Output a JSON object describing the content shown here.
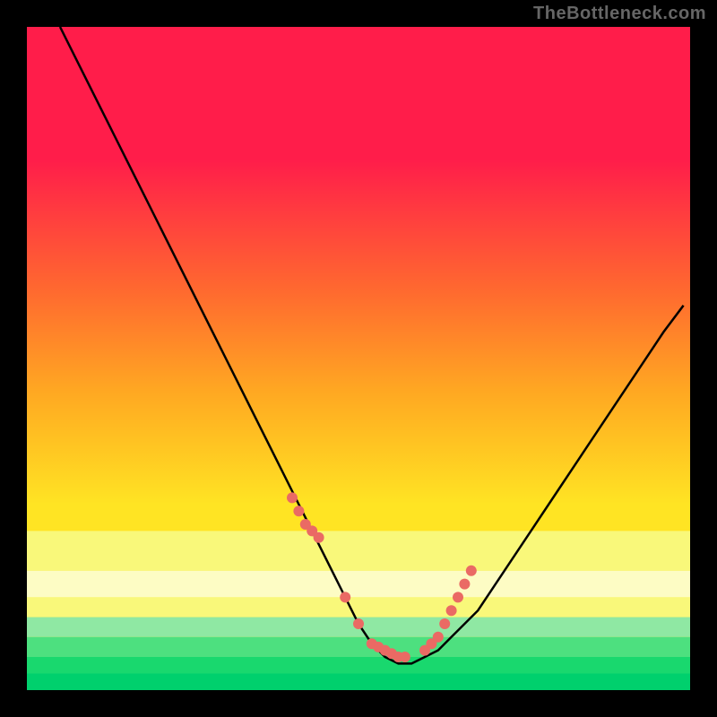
{
  "watermark": "TheBottleneck.com",
  "colors": {
    "bg": "#000000",
    "curve": "#000000",
    "points": "#ea6a64",
    "top": "#ff1d4a",
    "mid_red_orange": "#ff6a2f",
    "mid_orange": "#ffa822",
    "mid_yellow": "#ffe423",
    "band_light_yellow": "#f9f87a",
    "band_pale_yellow": "#fdfcc4",
    "band_mint1": "#8fe8a3",
    "band_mint2": "#4de07f",
    "band_green": "#19d86e",
    "band_green2": "#00d06d"
  },
  "chart_data": {
    "type": "line",
    "title": "",
    "xlabel": "",
    "ylabel": "",
    "xlim": [
      0,
      100
    ],
    "ylim": [
      0,
      100
    ],
    "curve": {
      "x": [
        5,
        8,
        12,
        16,
        20,
        24,
        28,
        32,
        36,
        40,
        44,
        46,
        48,
        50,
        52,
        54,
        56,
        58,
        60,
        62,
        64,
        68,
        72,
        76,
        80,
        84,
        88,
        92,
        96,
        99
      ],
      "y": [
        100,
        94,
        86,
        78,
        70,
        62,
        54,
        46,
        38,
        30,
        22,
        18,
        14,
        10,
        7,
        5,
        4,
        4,
        5,
        6,
        8,
        12,
        18,
        24,
        30,
        36,
        42,
        48,
        54,
        58
      ]
    },
    "points": {
      "x": [
        40,
        41,
        42,
        43,
        44,
        48,
        50,
        52,
        53,
        54,
        55,
        56,
        57,
        60,
        61,
        62,
        63,
        64,
        65,
        66,
        67
      ],
      "y": [
        29,
        27,
        25,
        24,
        23,
        14,
        10,
        7,
        6.5,
        6,
        5.5,
        5,
        5,
        6,
        7,
        8,
        10,
        12,
        14,
        16,
        18
      ]
    },
    "bottom_bands": [
      {
        "y0": 18,
        "y1": 24,
        "color_key": "band_light_yellow"
      },
      {
        "y0": 14,
        "y1": 18,
        "color_key": "band_pale_yellow"
      },
      {
        "y0": 11,
        "y1": 14,
        "color_key": "band_light_yellow"
      },
      {
        "y0": 8,
        "y1": 11,
        "color_key": "band_mint1"
      },
      {
        "y0": 5,
        "y1": 8,
        "color_key": "band_mint2"
      },
      {
        "y0": 2.5,
        "y1": 5,
        "color_key": "band_green"
      },
      {
        "y0": 0,
        "y1": 2.5,
        "color_key": "band_green2"
      }
    ]
  }
}
